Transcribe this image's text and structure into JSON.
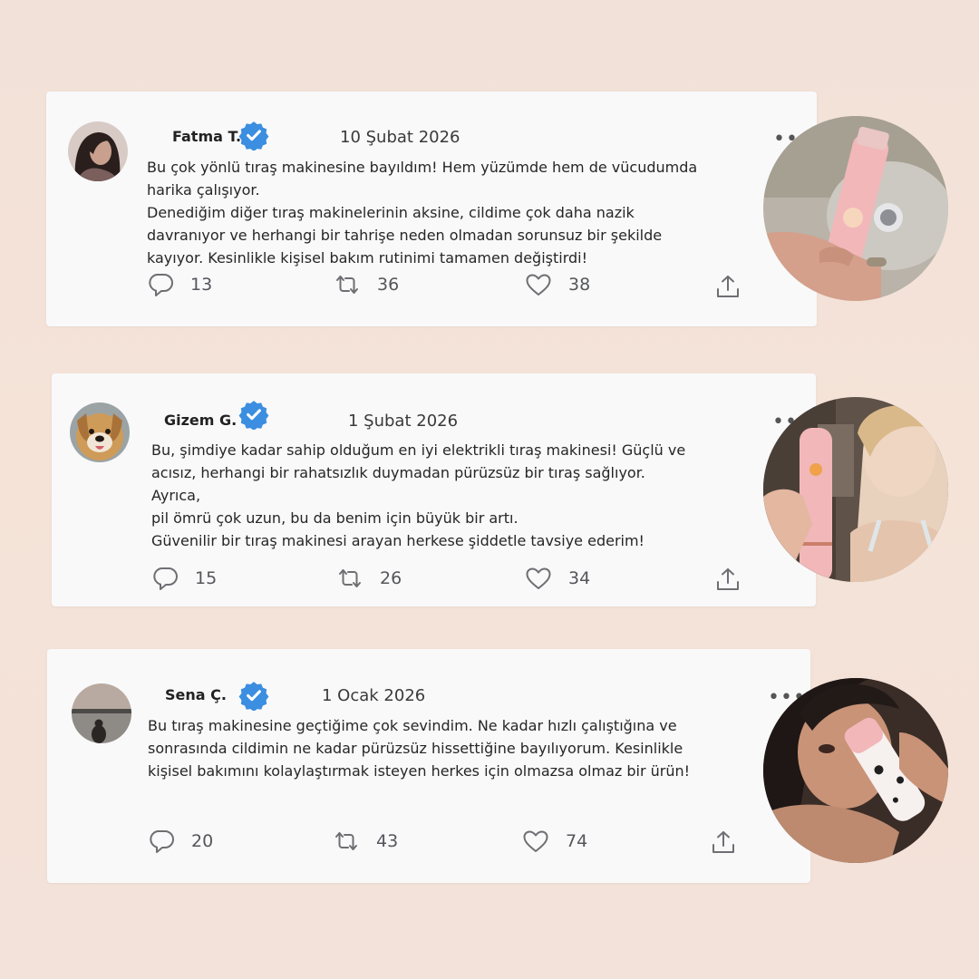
{
  "colors": {
    "background": "#f3e2d9",
    "card": "#f9f9fa",
    "verified": "#3b8ee0",
    "icon": "#6f6f73",
    "product_pink": "#f2b7b9"
  },
  "reviews": [
    {
      "name": "Fatma T.",
      "date": "10 Şubat 2026",
      "more": "•••",
      "avatar": "woman-dark-hair-avatar",
      "photo": "pink-trimmer-in-hand-photo",
      "lines": [
        "Bu çok yönlü tıraş makinesine bayıldım! Hem yüzümde hem de vücudumda",
        "harika çalışıyor.",
        "Denediğim diğer tıraş makinelerinin aksine, cildime çok daha nazik",
        "davranıyor ve herhangi bir tahrişe neden olmadan sorunsuz bir şekilde",
        "kayıyor. Kesinlikle kişisel bakım rutinimi tamamen değiştirdi!"
      ],
      "replies": "13",
      "retweets": "36",
      "likes": "38"
    },
    {
      "name": "Gizem G.",
      "date": "1 Şubat 2026",
      "more": "•••",
      "avatar": "golden-dog-avatar",
      "photo": "woman-holding-pink-trimmer-photo",
      "lines": [
        "Bu, şimdiye kadar sahip olduğum en iyi elektrikli tıraş makinesi! Güçlü ve",
        "acısız, herhangi bir rahatsızlık duymadan pürüzsüz bir tıraş sağlıyor.",
        "Ayrıca,",
        "pil ömrü çok uzun, bu da benim için büyük bir artı.",
        "Güvenilir bir tıraş makinesi arayan herkese şiddetle tavsiye ederim!"
      ],
      "replies": "15",
      "retweets": "26",
      "likes": "34"
    },
    {
      "name": "Sena Ç.",
      "date": "1 Ocak 2026",
      "more": "•••",
      "avatar": "sunset-lake-avatar",
      "photo": "woman-trimming-arm-photo",
      "lines": [
        "Bu tıraş makinesine geçtiğime çok sevindim. Ne kadar hızlı çalıştığına ve",
        "sonrasında cildimin ne kadar pürüzsüz hissettiğine bayılıyorum. Kesinlikle",
        "kişisel bakımını kolaylaştırmak isteyen herkes için olmazsa olmaz bir ürün!"
      ],
      "replies": "20",
      "retweets": "43",
      "likes": "74"
    }
  ]
}
